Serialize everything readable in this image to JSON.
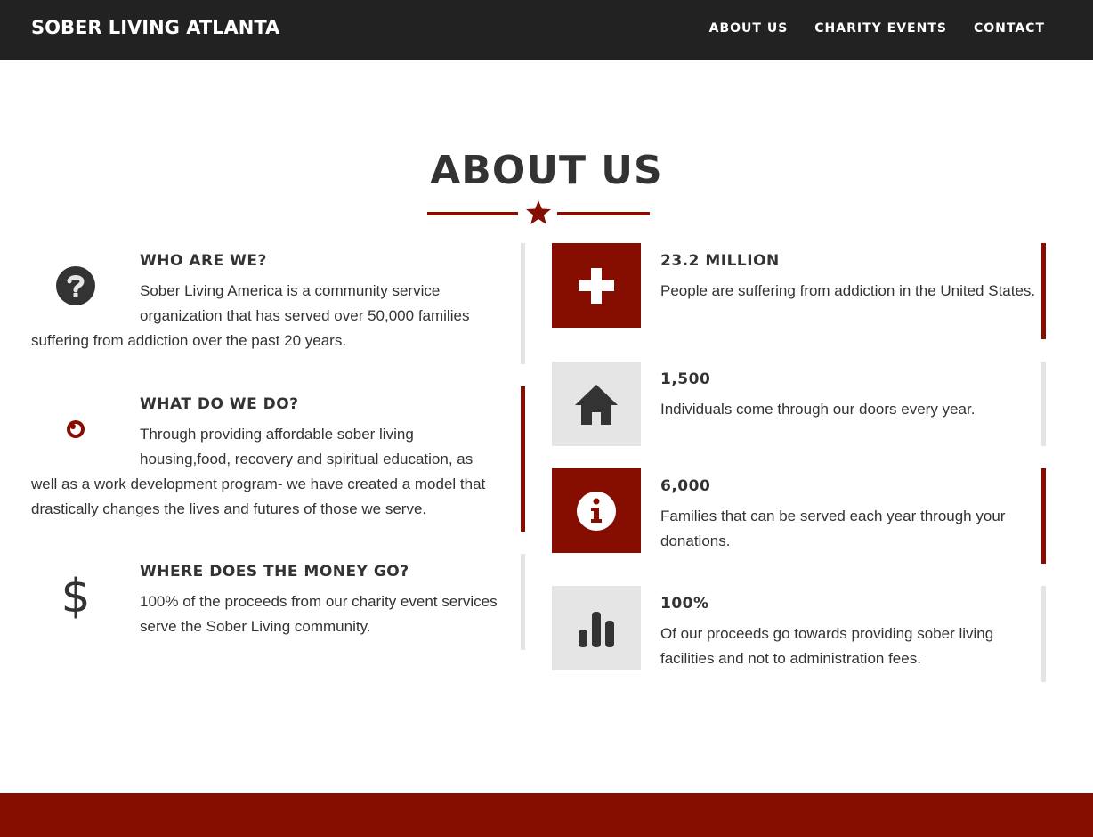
{
  "brand": "SOBER LIVING ATLANTA",
  "nav": {
    "about": "ABOUT US",
    "events": "CHARITY EVENTS",
    "contact": "CONTACT"
  },
  "section": {
    "title": "ABOUT US"
  },
  "left_items": [
    {
      "heading": "WHO ARE WE?",
      "text": "Sober Living America is a community service organization that has served over 50,000 families suffering from addiction over the past 20 years.",
      "icon": "question-icon"
    },
    {
      "heading": "WHAT DO WE DO?",
      "text": "Through providing affordable sober living housing,food, recovery and spiritual education, as well as a work development program- we have created a model that drastically changes the lives and futures of those we serve.",
      "icon": "eye-icon"
    },
    {
      "heading": "WHERE DOES THE MONEY GO?",
      "text": "100% of the proceeds from our charity event services serve the Sober Living community.",
      "icon": "dollar-icon",
      "glyph": "$"
    }
  ],
  "right_items": [
    {
      "heading": "23.2 MILLION",
      "text": "People are suffering from addiction in the United States.",
      "icon": "plus-icon"
    },
    {
      "heading": "1,500",
      "text": "Individuals come through our doors every year.",
      "icon": "home-icon"
    },
    {
      "heading": "6,000",
      "text": "Families that can be served each year through your donations.",
      "icon": "info-icon"
    },
    {
      "heading": "100%",
      "text": "Of our proceeds go towards providing sober living facilities and not to administration fees.",
      "icon": "bar-chart-icon"
    }
  ],
  "colors": {
    "accent": "#850e00",
    "dark": "#222222",
    "grey": "#e5e5e5",
    "text": "#333333"
  }
}
